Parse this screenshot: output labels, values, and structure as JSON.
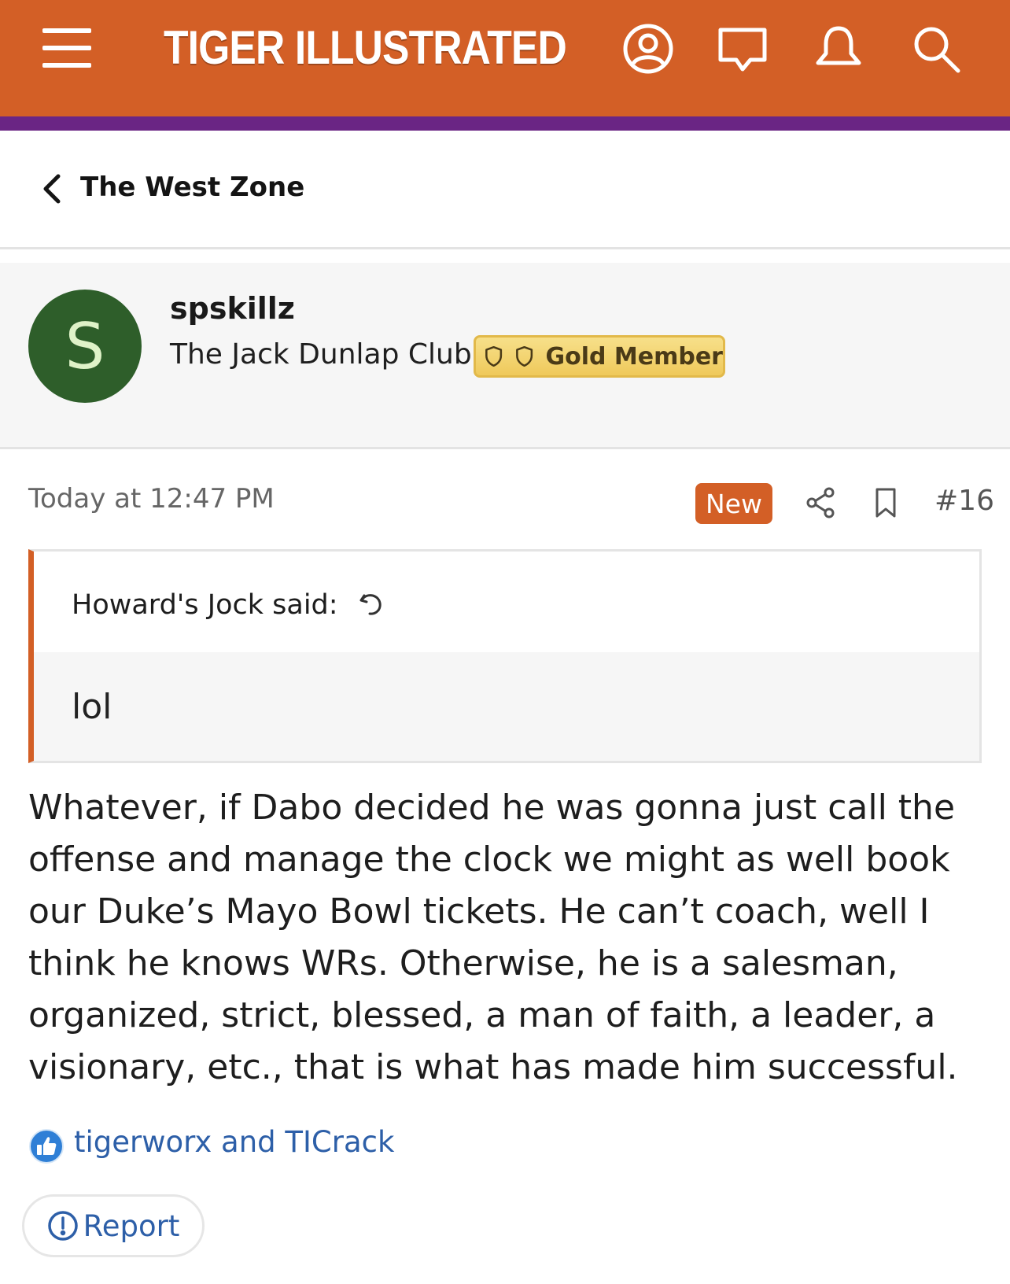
{
  "header": {
    "brand": "TIGER ILLUSTRATED",
    "icons": [
      "menu-icon",
      "account-icon",
      "messages-icon",
      "alerts-icon",
      "search-icon"
    ],
    "accent_color": "#d35f26",
    "stripe_color": "#6a2584"
  },
  "breadcrumb": {
    "label": "The West Zone"
  },
  "user": {
    "avatar_letter": "S",
    "avatar_color": "#2e5e2a",
    "username": "spskillz",
    "title": "The Jack Dunlap Club",
    "badge_label": "Gold Member"
  },
  "post": {
    "time": "Today at 12:47 PM",
    "new_label": "New",
    "number": "#16",
    "quote": {
      "author": "Howard's Jock said:",
      "text": "lol"
    },
    "body_lines": [
      "Whatever, if Dabo decided he was gonna just call the",
      "offense and manage the clock we might as well book",
      "our Duke’s Mayo Bowl tickets. He can’t coach, well I",
      "think he knows WRs. Otherwise, he is a salesman,",
      "organized, strict, blessed, a man of faith, a leader, a",
      "visionary, etc., that is what has made him successful."
    ],
    "reactions": "tigerworx and TICrack",
    "report_label": "Report"
  }
}
